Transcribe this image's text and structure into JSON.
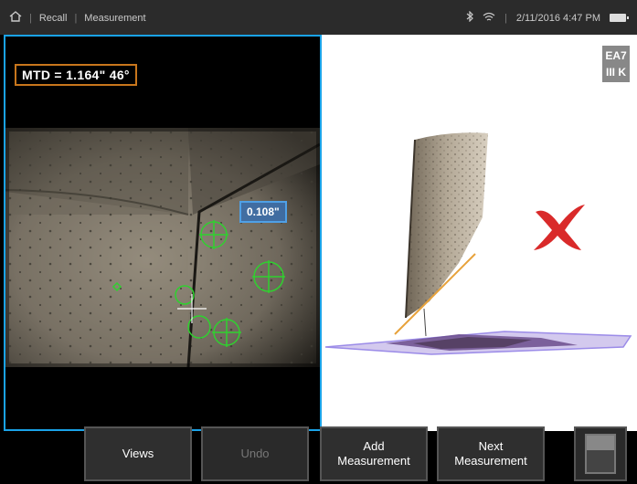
{
  "statusbar": {
    "home_icon": "home-icon",
    "crumb_1": "Recall",
    "crumb_2": "Measurement",
    "bluetooth_icon": "bluetooth-icon",
    "wifi_icon": "wifi-icon",
    "datetime": "2/11/2016 4:47 PM",
    "battery_icon": "battery-icon"
  },
  "measurement": {
    "mtd_label": "MTD = 1.164\" 46°",
    "depth_value": "0.108\""
  },
  "view3d": {
    "viewcube_label_top": "EA7",
    "viewcube_label_bottom": "III K",
    "status_icon": "x-mark-icon",
    "status_color": "#d92a2a"
  },
  "toolbar": {
    "views_label": "Views",
    "undo_label": "Undo",
    "add_label_1": "Add",
    "add_label_2": "Measurement",
    "next_label_1": "Next",
    "next_label_2": "Measurement"
  },
  "colors": {
    "accent": "#1aa3e8",
    "mtd_border": "#c8761c",
    "cursor_green": "#2fd12f"
  }
}
